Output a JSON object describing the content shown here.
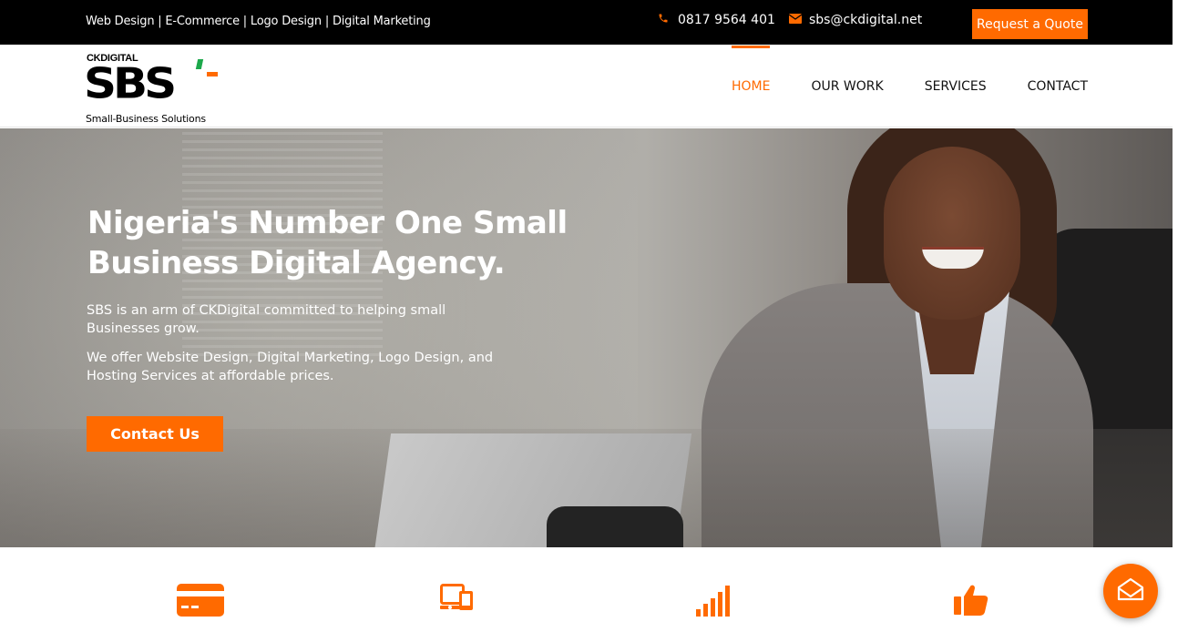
{
  "topbar": {
    "services_text": "Web Design | E-Commerce | Logo Design | Digital Marketing",
    "phone_icon": "phone-icon",
    "phone": "0817 9564 401",
    "email_icon": "envelope-icon",
    "email": "sbs@ckdigital.net",
    "quote_button": "Request a Quote"
  },
  "logo": {
    "brand_top": "CKDIGITAL",
    "brand_main": "SBS",
    "brand_sub": "Small-Business Solutions"
  },
  "nav": {
    "items": [
      {
        "label": "HOME",
        "active": true
      },
      {
        "label": "OUR WORK",
        "active": false
      },
      {
        "label": "SERVICES",
        "active": false
      },
      {
        "label": "CONTACT",
        "active": false
      }
    ]
  },
  "hero": {
    "title": "Nigeria's Number One Small Business Digital Agency.",
    "paragraph_1": "SBS is an arm of CKDigital committed to helping small Businesses grow.",
    "paragraph_2": "We offer Website Design, Digital Marketing, Logo Design, and Hosting Services at affordable prices.",
    "cta_button": "Contact Us"
  },
  "features": {
    "icons": [
      "credit-card-icon",
      "devices-icon",
      "signal-bars-icon",
      "thumbs-up-icon"
    ]
  },
  "floating_button": {
    "icon": "envelope-open-icon"
  },
  "colors": {
    "accent": "#ff6a00",
    "topbar_bg": "#000000",
    "nav_text": "#111111",
    "flag_green": "#1ca84b"
  }
}
